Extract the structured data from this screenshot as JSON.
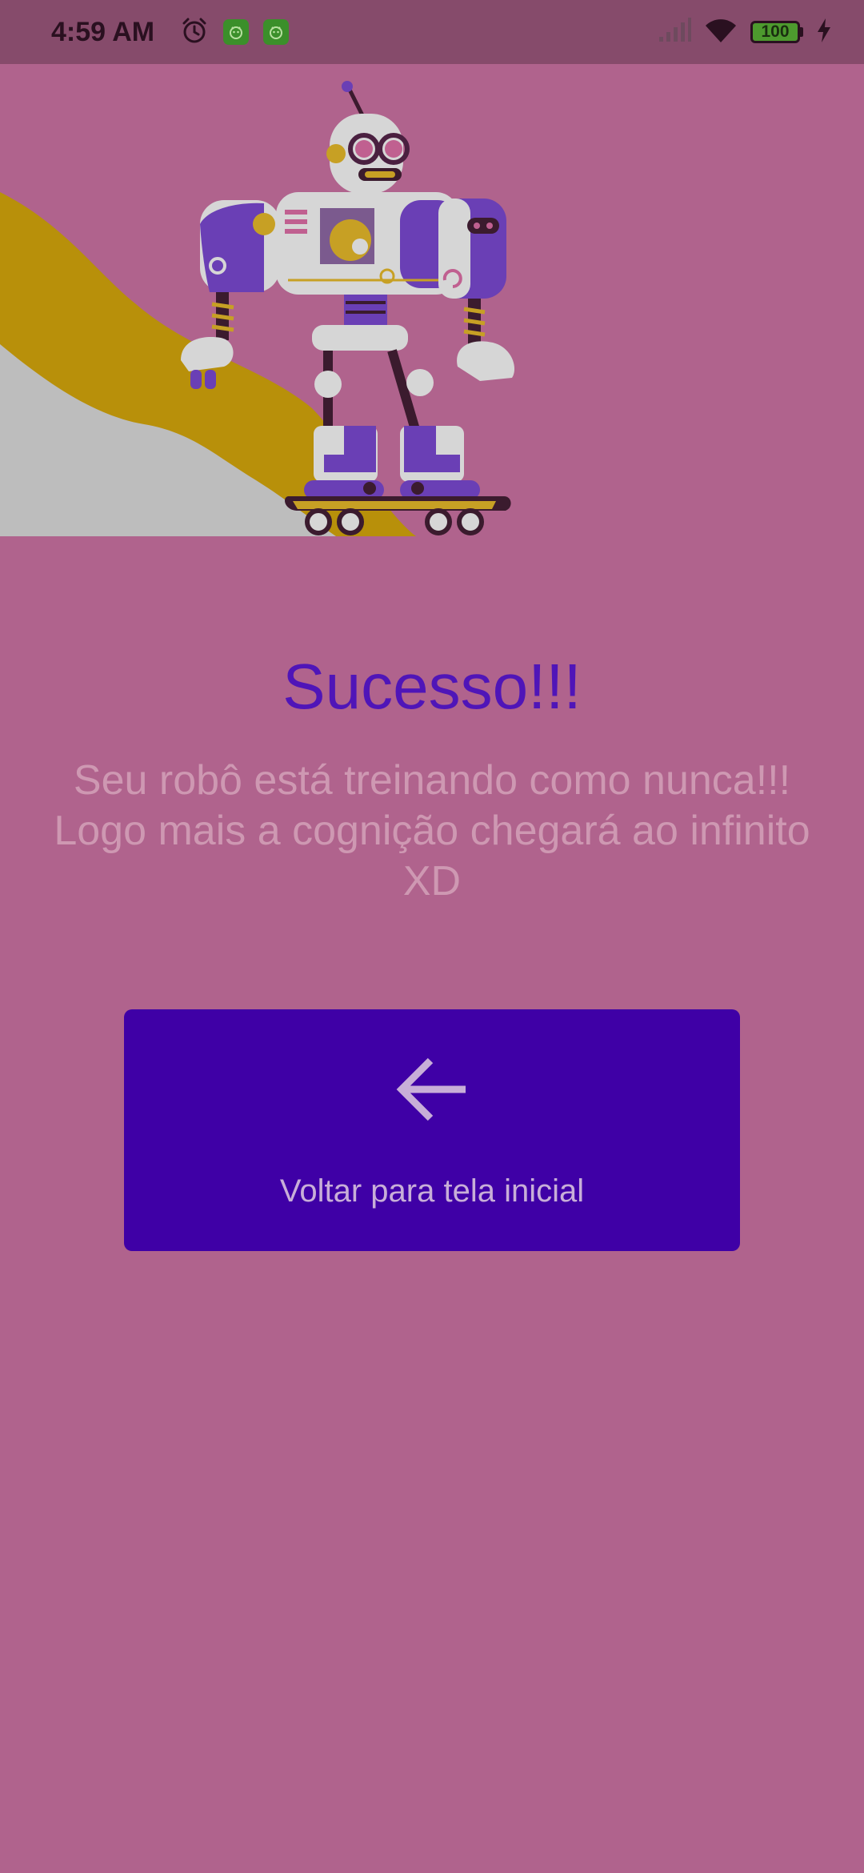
{
  "status_bar": {
    "time": "4:59 AM",
    "battery": "100",
    "icons": [
      "alarm-icon",
      "app-notification-icon",
      "app-notification-icon",
      "signal-icon",
      "wifi-icon",
      "battery-icon",
      "charging-icon"
    ]
  },
  "hero": {
    "illustration": "robot-skateboard-illustration"
  },
  "content": {
    "title": "Sucesso!!!",
    "message_lines": [
      "Seu robô está treinando como nunca!!!",
      "Logo mais a cognição chegará ao infinito",
      "XD"
    ]
  },
  "back_button": {
    "icon": "arrow-left-icon",
    "label": "Voltar para tela inicial"
  },
  "colors": {
    "background": "#B0638D",
    "status_bar": "#864B6B",
    "title": "#4F15B8",
    "message": "#CE98B2",
    "button": "#3F00A6",
    "button_text": "#C8AED8"
  }
}
